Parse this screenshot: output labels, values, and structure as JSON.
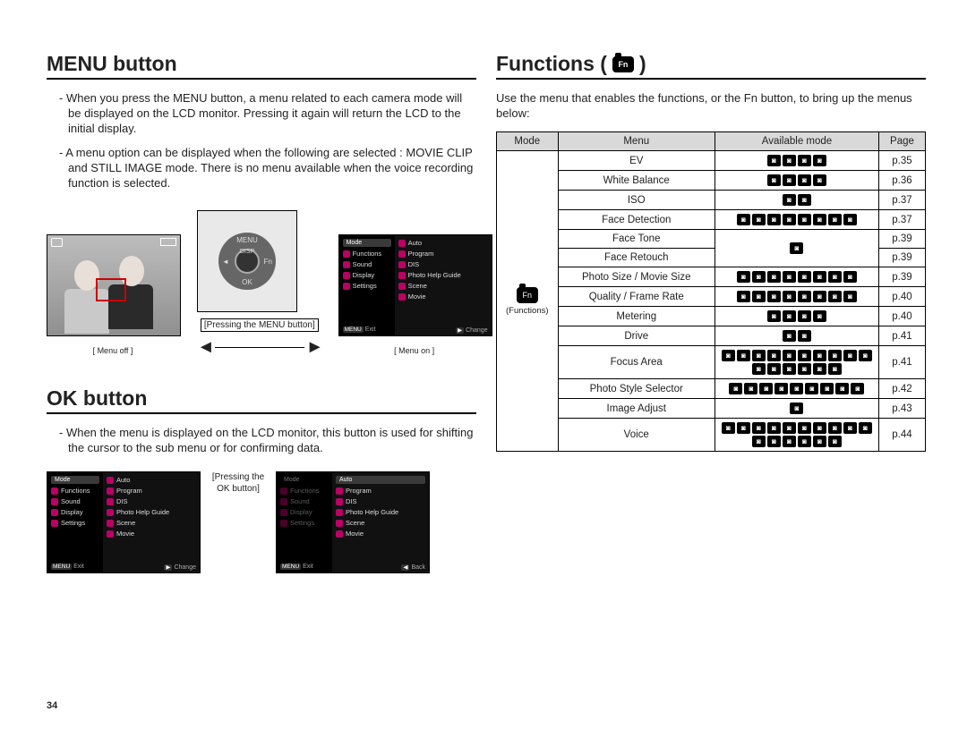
{
  "left": {
    "menu_heading": "MENU button",
    "menu_p1": "When you press the MENU button, a menu related to each camera mode will be displayed on the LCD monitor. Pressing it again will return the LCD to the initial display.",
    "menu_p2": "A menu option can be displayed when the following are selected : MOVIE CLIP and STILL IMAGE mode. There is no menu available when the voice recording function is selected.",
    "cap_menu_off": "[ Menu off ]",
    "cap_pressing_menu": "[Pressing the MENU button]",
    "cap_menu_on": "[ Menu on ]",
    "wheel": {
      "top": "MENU",
      "bottom": "OK",
      "left": "◄",
      "right": "Fn",
      "top2": "DISP"
    },
    "ok_heading": "OK button",
    "ok_p": "When the menu is displayed on the LCD monitor, this button is used for shifting the cursor to the sub menu or for confirming data.",
    "cap_pressing_ok": "[Pressing the OK button]",
    "menu_left_head": "Mode",
    "menu_left_items": [
      "Functions",
      "Sound",
      "Display",
      "Settings"
    ],
    "menu_right_items": [
      "Auto",
      "Program",
      "DIS",
      "Photo Help Guide",
      "Scene",
      "Movie"
    ],
    "foot_exit": "Exit",
    "foot_change": "Change",
    "foot_back": "Back",
    "foot_menu": "MENU",
    "foot_play": "▶"
  },
  "right": {
    "heading": "Functions (",
    "heading_tail": ")",
    "fn_label": "Fn",
    "intro": "Use the menu that enables the functions, or the Fn button, to bring up the menus below:",
    "th": [
      "Mode",
      "Menu",
      "Available mode",
      "Page"
    ],
    "mode_cell": {
      "label": "(Functions)"
    },
    "rows": [
      {
        "menu": "EV",
        "icons": 4,
        "page": "p.35"
      },
      {
        "menu": "White Balance",
        "icons": 4,
        "page": "p.36"
      },
      {
        "menu": "ISO",
        "icons": 2,
        "page": "p.37"
      },
      {
        "menu": "Face Detection",
        "icons": 8,
        "page": "p.37"
      },
      {
        "menu": "Face Tone",
        "icons": 1,
        "page": "p.39",
        "merged_up": true
      },
      {
        "menu": "Face Retouch",
        "icons": 0,
        "page": "p.39",
        "merged_down": true
      },
      {
        "menu": "Photo Size / Movie Size",
        "icons": 8,
        "page": "p.39"
      },
      {
        "menu": "Quality / Frame Rate",
        "icons": 8,
        "page": "p.40"
      },
      {
        "menu": "Metering",
        "icons": 4,
        "page": "p.40"
      },
      {
        "menu": "Drive",
        "icons": 2,
        "page": "p.41"
      },
      {
        "menu": "Focus Area",
        "icons": 16,
        "page": "p.41"
      },
      {
        "menu": "Photo Style Selector",
        "icons": 9,
        "page": "p.42"
      },
      {
        "menu": "Image Adjust",
        "icons": 1,
        "page": "p.43"
      },
      {
        "menu": "Voice",
        "icons": 16,
        "page": "p.44"
      }
    ]
  },
  "page_number": "34"
}
